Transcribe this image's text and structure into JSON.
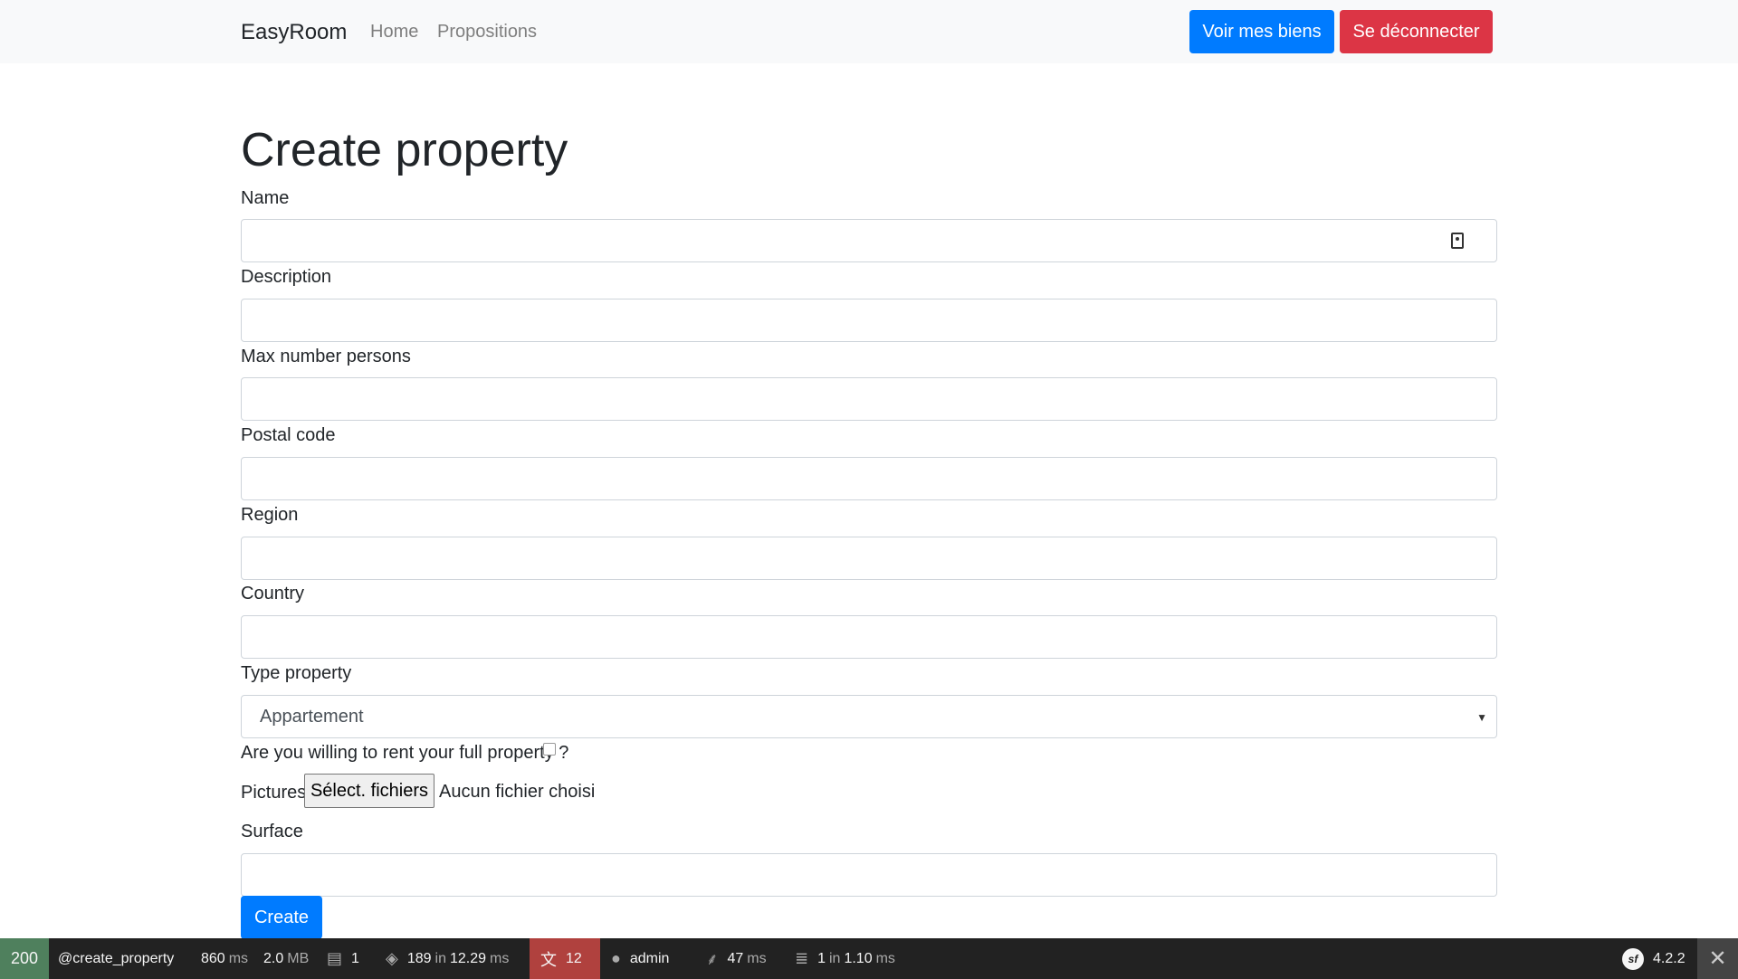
{
  "navbar": {
    "brand": "EasyRoom",
    "links": [
      "Home",
      "Propositions"
    ],
    "voir_biens_label": "Voir mes biens",
    "logout_label": "Se déconnecter"
  },
  "form": {
    "title": "Create property",
    "labels": {
      "name": "Name",
      "description": "Description",
      "max_persons": "Max number persons",
      "postal_code": "Postal code",
      "region": "Region",
      "country": "Country",
      "type_property": "Type property",
      "full_property": "Are you willing to rent your full property ?",
      "pictures": "Pictures",
      "surface": "Surface"
    },
    "values": {
      "name": "",
      "description": "",
      "max_persons": "",
      "postal_code": "",
      "region": "",
      "country": "",
      "surface": ""
    },
    "type_property_selected": "Appartement",
    "full_property_checked": false,
    "file_button_label": "Sélect. fichiers",
    "file_status": "Aucun fichier choisi",
    "submit_label": "Create"
  },
  "debug_toolbar": {
    "status_code": "200",
    "route": "@create_property",
    "time_value": "860",
    "time_unit": "ms",
    "memory_value": "2.0",
    "memory_unit": "MB",
    "logs_count": "1",
    "cache_count": "189",
    "cache_in": "in",
    "cache_time": "12.29",
    "cache_unit": "ms",
    "translation_count": "12",
    "user": "admin",
    "twig_time": "47",
    "twig_unit": "ms",
    "db_queries": "1",
    "db_in": "in",
    "db_time": "1.10",
    "db_unit": "ms",
    "symfony_version": "4.2.2",
    "colors": {
      "status_ok": "#4f805d",
      "translation_warning": "#b0413e",
      "background": "#222222"
    }
  },
  "colors": {
    "primary": "#007bff",
    "danger": "#dc3545",
    "navbar_bg": "#f8f9fa"
  }
}
